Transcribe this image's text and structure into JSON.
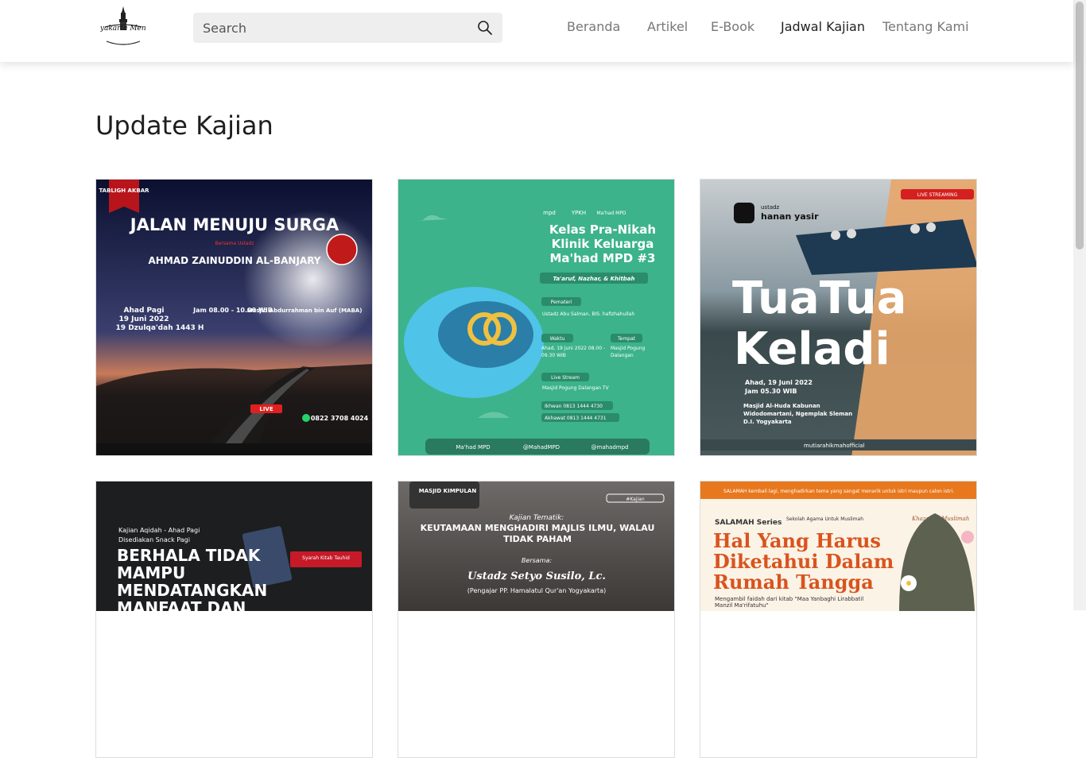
{
  "header": {
    "logo_alt": "Yogyakarta Mengaji",
    "search_placeholder": "Search",
    "nav": [
      {
        "label": "Beranda"
      },
      {
        "label": "Artikel"
      },
      {
        "label": "E-Book"
      },
      {
        "label": "Jadwal Kajian",
        "active": true
      },
      {
        "label": "Tentang Kami"
      }
    ]
  },
  "main": {
    "title": "Update Kajian"
  },
  "posters": [
    {
      "badge": "TABLIGH AKBAR",
      "title": "JALAN MENUJU SURGA",
      "speaker_prefix": "Bersama Ustadz",
      "speaker": "AHMAD ZAINUDDIN AL-BANJARY",
      "day": "Ahad Pagi",
      "date": "19 Juni 2022",
      "hijri": "19 Dzulqa'dah 1443 H",
      "time": "Jam 08.00 - 10.00 WIB",
      "venue": "Masjid Abdurrahman bin Auf (MABA)",
      "live": "LIVE",
      "contact": "0822 3708 4024"
    },
    {
      "orgs": [
        "mpd",
        "YPKH",
        "Ma'had MPD"
      ],
      "title": "Kelas Pra-Nikah Klinik Keluarga Ma'had MPD #3",
      "subtitle": "Ta'aruf, Nazhar, & Khitbah",
      "pemateri_label": "Pemateri",
      "pemateri": "Ustadz Abu Salman, BIS. hafizhahullah",
      "waktu_label": "Waktu",
      "waktu": "Ahad, 19 Juni 2022 08.00 - 09.30 WIB",
      "tempat_label": "Tempat",
      "tempat": "Masjid Pogung Dalangan",
      "stream_label": "Live Stream",
      "stream": "Masjid Pogung Dalangan TV",
      "ikhwan": "Ikhwan 0813 1444 4730",
      "akhawat": "Akhawat 0813 1444 4731",
      "social": [
        "Ma'had MPD",
        "@MahadMPD",
        "@mahadmpd"
      ]
    },
    {
      "ustadz_small": "ustadz",
      "ustadz_name": "hanan yasir",
      "live": "LIVE STREAMING",
      "title1": "TuaTua",
      "title2": "Keladi",
      "date": "Ahad, 19 Juni 2022",
      "time": "Jam 05.30 WIB",
      "venue": "Masjid Al-Huda Kabunan Widodomartani, Ngemplak Sleman D.I. Yogyakarta",
      "footer": "mutiarahikmahofficial"
    },
    {
      "line1": "Kajian Aqidah - Ahad Pagi",
      "line2": "Disediakan Snack Pagi",
      "title": "BERHALA TIDAK MAMPU MENDATANGKAN MANFAAT DAN",
      "tag": "Syarah Kitab Tauhid"
    },
    {
      "org": "MASJID KIMPULAN",
      "tag": "#Kajian",
      "kajian": "Kajian Tematik:",
      "title": "KEUTAMAAN MENGHADIRI MAJLIS ILMU, WALAU TIDAK PAHAM",
      "bersama": "Bersama:",
      "speaker": "Ustadz Setyo Susilo, Lc.",
      "role": "(Pengajar PP. Hamalatul Qur'an Yogyakarta)"
    },
    {
      "top": "SALAMAH kembali lagi, menghadirkan tema yang sangat menarik untuk istri maupun calon istri.",
      "series": "SALAMAH Series",
      "school": "Sekolah Agama Untuk Muslimah",
      "brand": "Khazanah Muslimah",
      "title": "Hal Yang Harus Diketahui Dalam Rumah Tangga",
      "note": "Mengambil faidah dari kitab \"Maa Yanbaghi Lirabbatil Manzil Ma'rifatuhu\""
    }
  ],
  "colors": {
    "accent_green": "#3cb38a",
    "orange": "#e8781e",
    "dark": "#1e1e1e"
  }
}
